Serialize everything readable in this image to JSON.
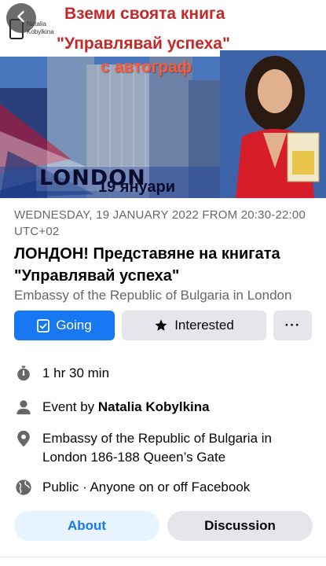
{
  "cover": {
    "headline_line1": "Вземи своята книга",
    "headline_line2": "\"Управлявай успеха\"",
    "headline_line3": "с автограф",
    "city_text": "LONDON",
    "date_text": "19 януари",
    "logo_text": "Natalia Kobylkina",
    "accent_color": "#c62828"
  },
  "nav": {
    "back_icon": "chevron-left-icon"
  },
  "event": {
    "datetime": "WEDNESDAY, 19 JANUARY 2022 FROM 20:30-22:00 UTC+02",
    "title": "ЛОНДОН! Представяне на книгата \"Управлявай успеха\"",
    "venue": "Embassy of the Republic of Bulgaria in London"
  },
  "actions": {
    "going": {
      "label": "Going",
      "icon": "calendar-check-icon",
      "color": "#1877f2"
    },
    "interested": {
      "label": "Interested",
      "icon": "star-icon"
    },
    "more": {
      "label": "···",
      "icon": "more-icon"
    }
  },
  "details": {
    "duration": "1 hr 30 min",
    "host_prefix": "Event by",
    "host_name": "Natalia Kobylkina",
    "location": "Embassy of the Republic of Bulgaria in London 186-188 Queen’s Gate",
    "privacy": "Public · Anyone on or off Facebook"
  },
  "tabs": {
    "about": "About",
    "discussion": "Discussion",
    "active": "about"
  }
}
